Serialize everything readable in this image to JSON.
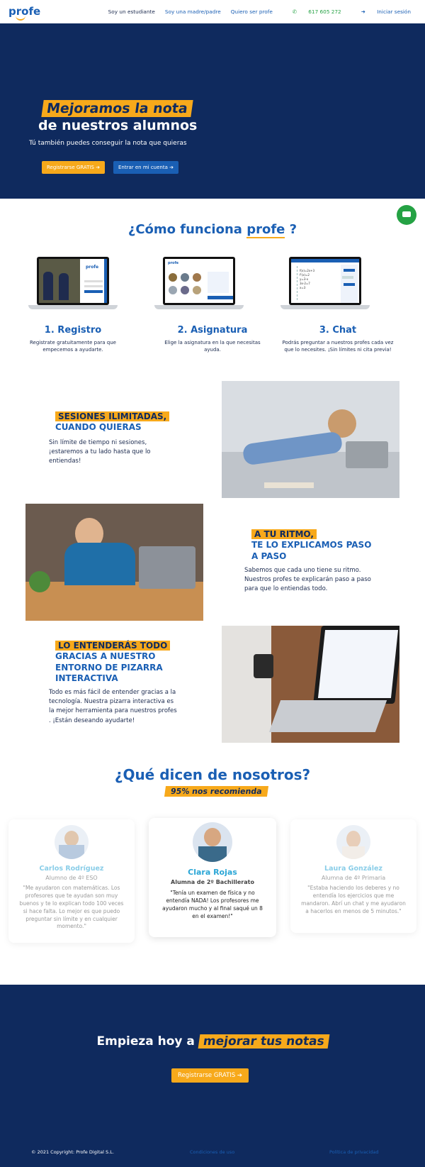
{
  "nav": {
    "logo": "profe",
    "links": [
      "Soy un estudiante",
      "Soy una madre/padre",
      "Quiero ser profe"
    ],
    "phone": "617 605 272",
    "login": "Iniciar sesión"
  },
  "hero": {
    "title_highlight": "Mejoramos la nota",
    "title_rest": "de nuestros alumnos",
    "subtitle": "Tú también puedes conseguir la nota que quieras",
    "btn_register": "Registrarse GRATIS ➔",
    "btn_enter": "Entrar en mi cuenta ➔"
  },
  "how": {
    "title": "¿Cómo funciona",
    "logo": "profe",
    "qmark": "?",
    "steps": [
      {
        "title": "1. Registro",
        "text": "Registrate gratuitamente para que empecemos a ayudarte."
      },
      {
        "title": "2. Asignatura",
        "text": "Elige la asignatura en la que necesitas ayuda."
      },
      {
        "title": "3. Chat",
        "text": "Podrás preguntar a nuestros profes cada vez que lo necesites. ¡Sin límites ni cita previa!"
      }
    ]
  },
  "features": [
    {
      "highlight": "SESIONES ILIMITADAS,",
      "heading": "CUANDO QUIERAS",
      "text": "Sin límite de tiempo ni sesiones, ¡estaremos a tu lado hasta que lo entiendas!"
    },
    {
      "highlight": "A TU RITMO,",
      "heading": "TE LO EXPLICAMOS PASO A PASO",
      "text": "Sabemos que cada uno tiene su ritmo. Nuestros profes te explicarán paso a paso para que lo entiendas todo."
    },
    {
      "highlight": "LO ENTENDERÁS TODO",
      "heading": "GRACIAS A NUESTRO ENTORNO DE PIZARRA INTERACTIVA",
      "text": "Todo es más fácil de entender gracias a la tecnología. Nuestra pizarra interactiva es la mejor herramienta para nuestros profes . ¡Están deseando ayudarte!"
    }
  ],
  "testimonials": {
    "title": "¿Qué dicen de nosotros?",
    "badge": "95% nos recomienda",
    "items": [
      {
        "name": "Carlos Rodríguez",
        "role": "Alumno de 4º ESO",
        "quote": "\"Me ayudaron con matemáticas. Los profesores que te ayudan son muy buenos y te lo explican todo 100 veces si hace falta. Lo mejor es que puedo preguntar sin límite y en cualquier momento.\""
      },
      {
        "name": "Clara Rojas",
        "role": "Alumna de 2º Bachillerato",
        "quote": "\"Tenía un examen de física y no entendía NADA! Los profesores me ayudaron mucho y al final saqué un 8 en el examen!\""
      },
      {
        "name": "Laura González",
        "role": "Alumna de 4º Primaria",
        "quote": "\"Estaba haciendo los deberes y no entendía los ejercicios que me mandaron. Abrí un chat y me ayudaron a hacerlos en menos de 5 minutos.\""
      }
    ]
  },
  "cta": {
    "text": "Empieza hoy a",
    "highlight": "mejorar tus notas",
    "button": "Registrarse GRATIS ➔"
  },
  "footer": {
    "copyright": "© 2021 Copyright: Profe Digital S.L.",
    "terms": "Condiciones de uso",
    "privacy": "Política de privacidad"
  },
  "colors": {
    "navy": "#0f2a5e",
    "orange": "#f7a91b",
    "blue": "#1a5fb4",
    "green": "#25a244"
  }
}
